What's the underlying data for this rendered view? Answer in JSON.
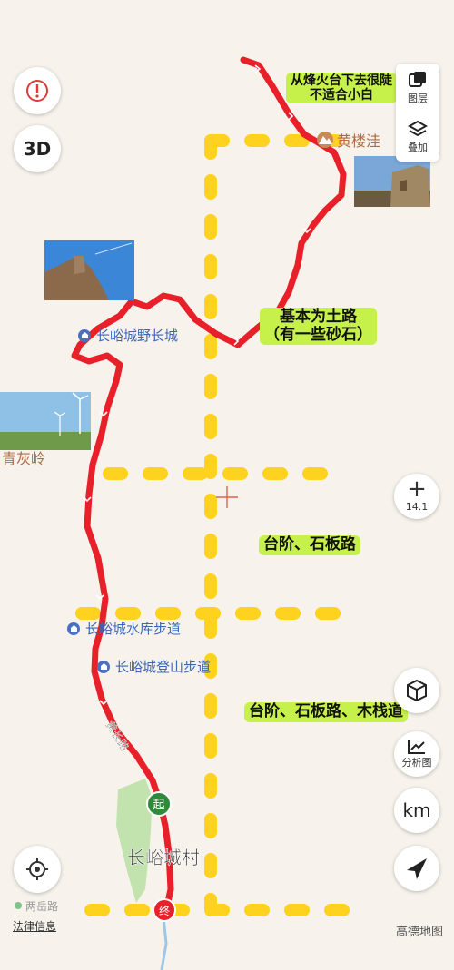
{
  "controls": {
    "layers_label": "图层",
    "overlay_label": "叠加",
    "three_d_label": "3D",
    "zoom_level": "14.1",
    "analysis_label": "分析图",
    "km_label": "km",
    "legal_label": "法律信息",
    "brand_label": "高德地图"
  },
  "map": {
    "callouts": {
      "steep_line1": "从烽火台下去很陡",
      "steep_line2": "不适合小白",
      "dirt_line1": "基本为土路",
      "dirt_line2": "（有一些砂石）",
      "steps": "台阶、石板路",
      "steps_boardwalk": "台阶、石板路、木栈道"
    },
    "places": {
      "huanglouwa": "黄楼洼",
      "wild_wall": "长峪城野长城",
      "qinghuiling": "青灰岭",
      "reservoir_trail": "长峪城水库步道",
      "climbing_trail": "长峪城登山步道",
      "village": "长峪城村",
      "huangchang_road": "黄长路",
      "liangyu_road": "两岳路",
      "start_marker": "起",
      "end_marker": "终"
    },
    "colors": {
      "route": "#e8202a",
      "grid_dash": "#ffd21f",
      "callout_bg": "#c6f04a",
      "poi_blue": "#4a70c4",
      "start_green": "#2e8b3a"
    }
  }
}
